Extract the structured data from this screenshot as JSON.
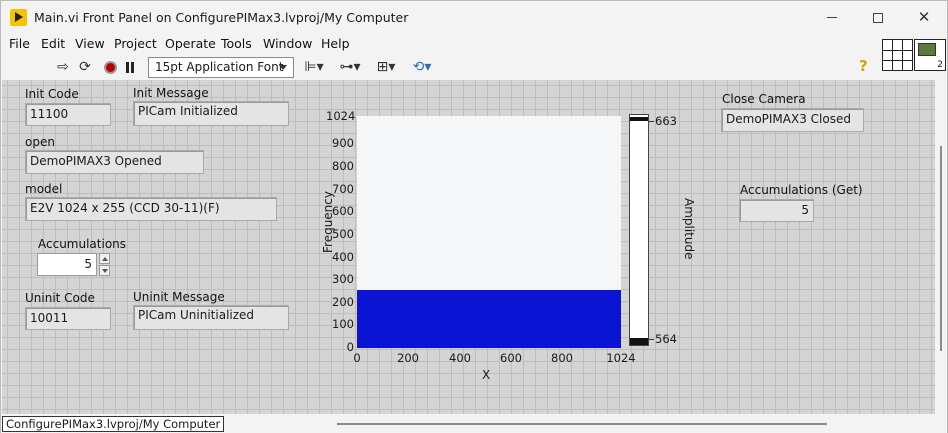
{
  "window": {
    "title": "Main.vi Front Panel on ConfigurePIMax3.lvproj/My Computer"
  },
  "menu": [
    "File",
    "Edit",
    "View",
    "Project",
    "Operate",
    "Tools",
    "Window",
    "Help"
  ],
  "toolbar": {
    "font_select": "15pt Application Font",
    "icons": [
      "run-icon",
      "run-continuously-icon",
      "abort-icon",
      "pause-icon",
      "align-objects-icon",
      "distribute-objects-icon",
      "resize-objects-icon",
      "reorder-icon",
      "help-icon"
    ]
  },
  "vi_icon_number": "2",
  "panel": {
    "init_code": {
      "label": "Init Code",
      "value": "11100"
    },
    "init_message": {
      "label": "Init Message",
      "value": "PICam Initialized"
    },
    "open": {
      "label": "open",
      "value": "DemoPIMAX3 Opened"
    },
    "model": {
      "label": "model",
      "value": "E2V 1024 x 255 (CCD 30-11)(F)"
    },
    "accumulations": {
      "label": "Accumulations",
      "value": "5"
    },
    "uninit_code": {
      "label": "Uninit Code",
      "value": "10011"
    },
    "uninit_message": {
      "label": "Uninit Message",
      "value": "PICam Uninitialized"
    },
    "close_camera": {
      "label": "Close Camera",
      "value": "DemoPIMAX3 Closed"
    },
    "accumulations_get": {
      "label": "Accumulations (Get)",
      "value": "5"
    }
  },
  "graph": {
    "ylabel": "Frequency",
    "xlabel": "X",
    "amplitude_label": "Amplitude",
    "y_ticks": [
      "1024",
      "900",
      "800",
      "700",
      "600",
      "500",
      "400",
      "300",
      "200",
      "100",
      "0"
    ],
    "x_ticks": [
      "0",
      "200",
      "400",
      "600",
      "800",
      "1024"
    ],
    "ramp_max": "663",
    "ramp_min": "564",
    "fill_top_y": 255,
    "y_max": 1024,
    "fill_color": "#0a14d2"
  },
  "status": {
    "path": "ConfigurePIMax3.lvproj/My Computer"
  }
}
